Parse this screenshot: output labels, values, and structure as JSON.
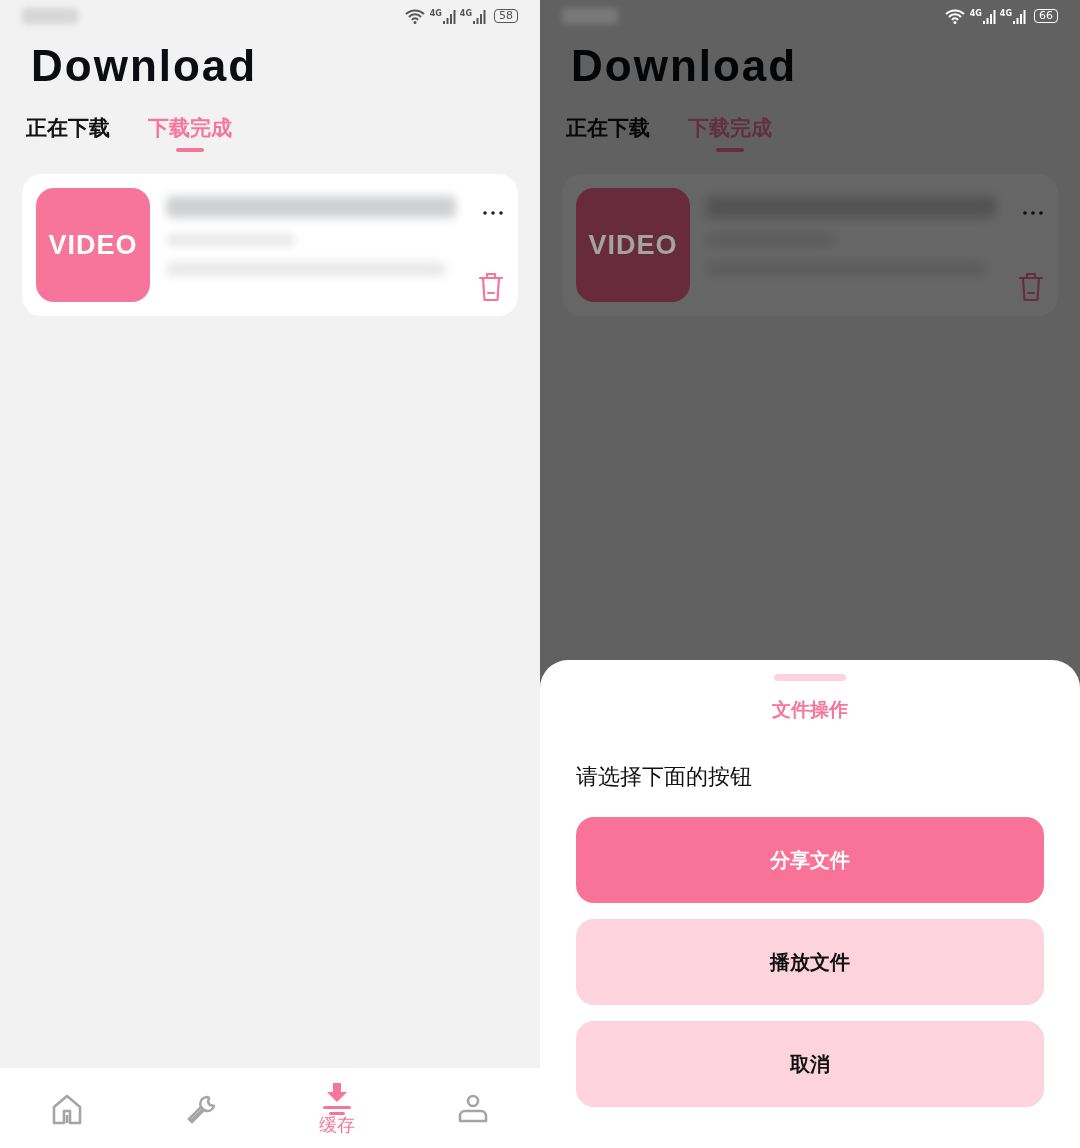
{
  "screens": [
    {
      "dimmed": false,
      "status_bar": {
        "network": [
          "4G",
          "4G"
        ],
        "battery": "58"
      },
      "title": "Download",
      "tabs": [
        {
          "label": "正在下载",
          "selected": false
        },
        {
          "label": "下载完成",
          "selected": true
        }
      ],
      "downloads": [
        {
          "thumbnail": "VIDEO"
        }
      ],
      "bottom_nav": [
        {
          "kind": "home",
          "selected": false
        },
        {
          "kind": "tools",
          "selected": false
        },
        {
          "kind": "download",
          "label": "缓存",
          "selected": true
        },
        {
          "kind": "profile",
          "selected": false
        }
      ]
    },
    {
      "dimmed": true,
      "status_bar": {
        "network": [
          "4G",
          "4G"
        ],
        "battery": "66"
      },
      "title": "Download",
      "tabs": [
        {
          "label": "正在下载",
          "selected": false
        },
        {
          "label": "下载完成",
          "selected": true
        }
      ],
      "downloads": [
        {
          "thumbnail": "VIDEO"
        }
      ],
      "sheet": {
        "title": "文件操作",
        "prompt": "请选择下面的按钮",
        "buttons": [
          {
            "label": "分享文件",
            "kind": "primary"
          },
          {
            "label": "播放文件",
            "kind": "secondary"
          },
          {
            "label": "取消",
            "kind": "secondary"
          }
        ]
      }
    }
  ]
}
